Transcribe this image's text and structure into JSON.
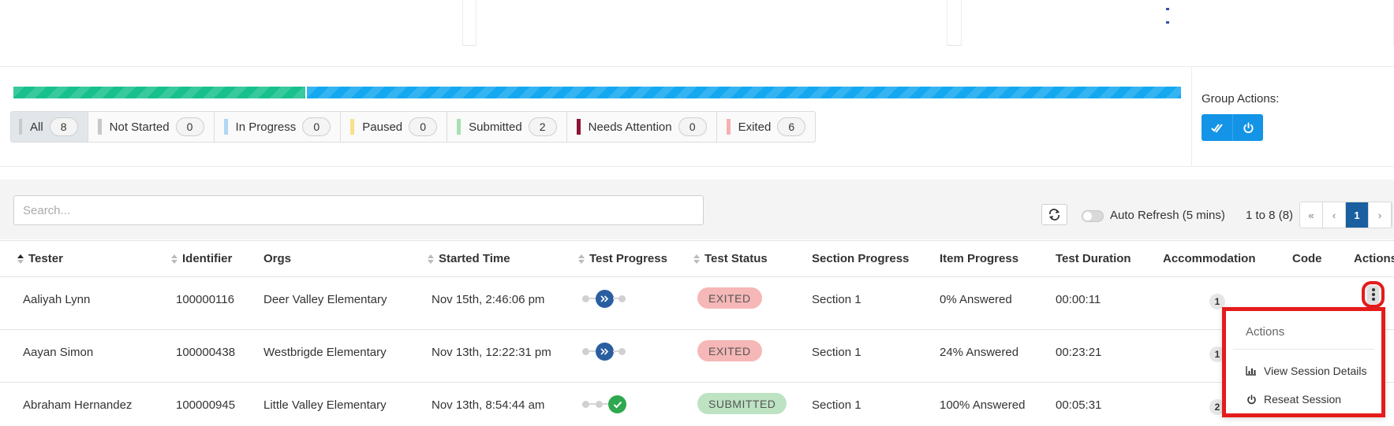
{
  "colors": {
    "accent": "#1394e6",
    "progress_submitted": "#17c08c",
    "progress_exited": "#14a8f0",
    "not_started": "#c8c8c8",
    "in_progress": "#b3d7f2",
    "paused": "#f8e08a",
    "submitted": "#a9dfb0",
    "needs_attention": "#8b1537",
    "exited": "#f6b0b0",
    "highlight_outline": "#e51b1b"
  },
  "status_progress": {
    "submitted_fraction": 0.25,
    "exited_fraction": 0.75
  },
  "filters": [
    {
      "label": "All",
      "count": "8"
    },
    {
      "label": "Not Started",
      "count": "0"
    },
    {
      "label": "In Progress",
      "count": "0"
    },
    {
      "label": "Paused",
      "count": "0"
    },
    {
      "label": "Submitted",
      "count": "2"
    },
    {
      "label": "Needs Attention",
      "count": "0"
    },
    {
      "label": "Exited",
      "count": "6"
    }
  ],
  "group_actions": {
    "title": "Group Actions:",
    "buttons": [
      {
        "icon": "double-check-icon"
      },
      {
        "icon": "power-icon"
      }
    ]
  },
  "toolbar": {
    "search_placeholder": "Search...",
    "refresh_icon": "refresh-icon",
    "auto_refresh_label": "Auto Refresh (5 mins)",
    "auto_refresh_on": false,
    "range_text": "1 to 8 (8)",
    "pager": {
      "first": "«",
      "prev": "‹",
      "current": "1",
      "next": "›"
    }
  },
  "table": {
    "columns": [
      "Tester",
      "Identifier",
      "Orgs",
      "Started Time",
      "Test Progress",
      "Test Status",
      "Section Progress",
      "Item Progress",
      "Test Duration",
      "Accommodation",
      "Code",
      "Actions"
    ],
    "rows": [
      {
        "tester": "Aaliyah Lynn",
        "identifier": "100000116",
        "org": "Deer Valley Elementary",
        "started": "Nov 15th, 2:46:06 pm",
        "progress_state": "exited",
        "status": "EXITED",
        "section": "Section 1",
        "items": "0% Answered",
        "duration": "00:00:11",
        "accommodation": "1",
        "code": ""
      },
      {
        "tester": "Aayan Simon",
        "identifier": "100000438",
        "org": "Westbrigde Elementary",
        "started": "Nov 13th, 12:22:31 pm",
        "progress_state": "exited",
        "status": "EXITED",
        "section": "Section 1",
        "items": "24% Answered",
        "duration": "00:23:21",
        "accommodation": "1",
        "code": ""
      },
      {
        "tester": "Abraham Hernandez",
        "identifier": "100000945",
        "org": "Little Valley Elementary",
        "started": "Nov 13th, 8:54:44 am",
        "progress_state": "submitted",
        "status": "SUBMITTED",
        "section": "Section 1",
        "items": "100% Answered",
        "duration": "00:05:31",
        "accommodation": "2",
        "code": ""
      }
    ]
  },
  "actions_menu": {
    "title": "Actions",
    "items": [
      {
        "label": "View Session Details",
        "icon": "bar-chart-icon"
      },
      {
        "label": "Reseat Session",
        "icon": "power-icon"
      }
    ]
  }
}
